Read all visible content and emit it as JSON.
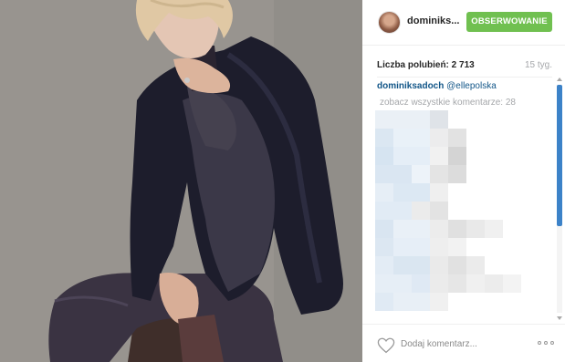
{
  "post": {
    "image_icon": "portrait-photo",
    "author": {
      "username": "dominiks...",
      "avatar_icon": "user-avatar"
    },
    "follow_button_label": "OBSERWOWANIE",
    "likes_text": "Liczba polubień: 2 713",
    "time_ago": "15 tyg.",
    "caption": {
      "username": "dominiksadoch",
      "text": "@ellepolska"
    },
    "view_all_comments": "zobacz wszystkie komentarze: 28",
    "comments_pixelated": true,
    "add_comment_placeholder": "Dodaj komentarz...",
    "more_options_icon": "ellipsis-icon",
    "like_icon": "heart-icon"
  },
  "colors": {
    "follow_button": "#70c050",
    "username_link": "#125688",
    "muted_text": "#a5a7aa",
    "scrollbar_thumb": "#3c82c8"
  }
}
